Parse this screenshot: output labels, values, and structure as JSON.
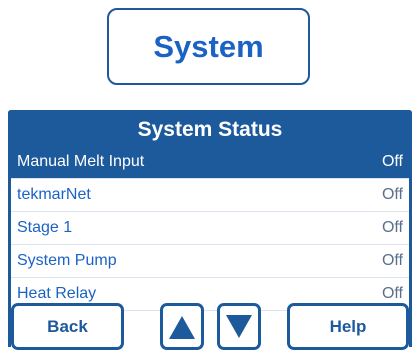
{
  "title_button": {
    "label": "System"
  },
  "status_panel": {
    "header": "System Status",
    "rows": [
      {
        "label": "Manual Melt Input",
        "value": "Off"
      },
      {
        "label": "tekmarNet",
        "value": "Off"
      },
      {
        "label": "Stage 1",
        "value": "Off"
      },
      {
        "label": "System Pump",
        "value": "Off"
      },
      {
        "label": "Heat Relay",
        "value": "Off"
      }
    ]
  },
  "buttons": {
    "back": "Back",
    "up_icon": "up-arrow-icon",
    "down_icon": "down-arrow-icon",
    "help": "Help"
  },
  "colors": {
    "primary": "#1d5a9c",
    "text_blue": "#1b62c5",
    "background": "#ffffff"
  }
}
